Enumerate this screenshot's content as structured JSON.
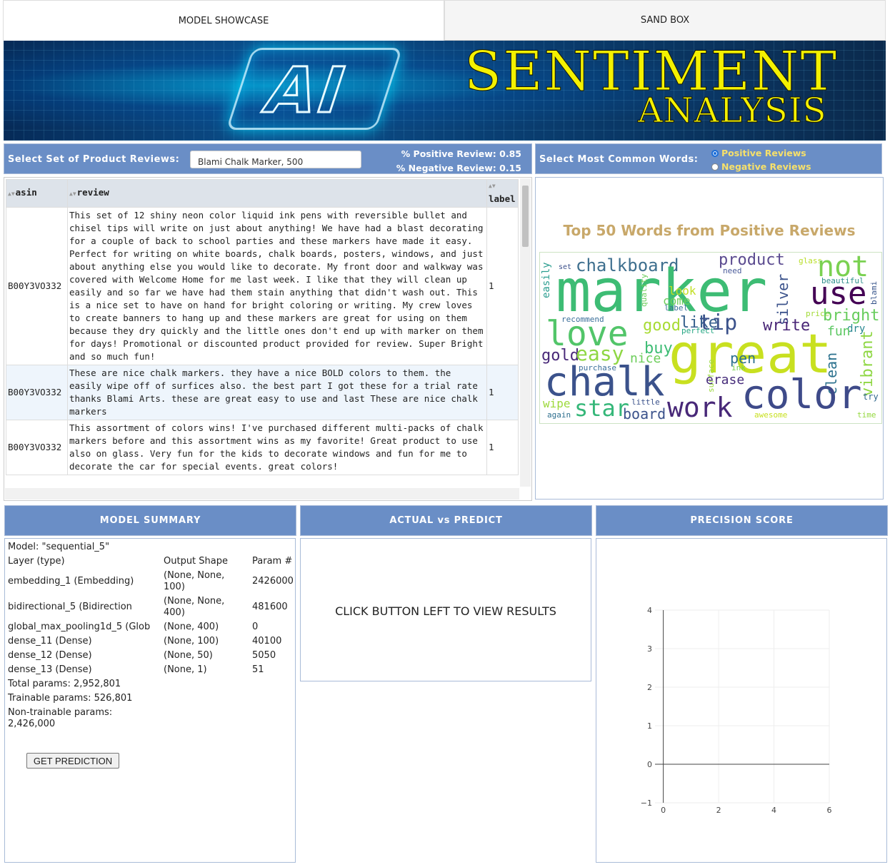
{
  "tabs": [
    {
      "label": "MODEL SHOWCASE"
    },
    {
      "label": "SAND BOX"
    }
  ],
  "banner": {
    "ai": "AI",
    "title": "SENTIMENT",
    "subtitle": "ANALYSIS"
  },
  "reviews_select": {
    "label": "Select Set of Product Reviews:",
    "value": "Blami Chalk Marker, 500",
    "positive": "% Positive Review: 0.85",
    "negative": "% Negative Review: 0.15"
  },
  "words_select": {
    "label": "Select Most Common Words:",
    "options": [
      "Positive Reviews",
      "Negative Reviews"
    ],
    "selected": "Positive Reviews"
  },
  "table": {
    "columns": [
      "asin",
      "review",
      "label"
    ],
    "rows": [
      {
        "asin": "B00Y3VO332",
        "review": "This set of 12 shiny neon color liquid ink pens with reversible bullet and chisel tips will write on just about anything! We have had a blast decorating for a couple of back to school parties and these markers have made it easy. Perfect for writing on white boards, chalk boards, posters, windows, and just about anything else you would like to decorate. My front door and walkway was covered with Welcome Home for me last week. I like that they will clean up easily and so far we have had them stain anything that didn't wash out. This is a nice set to have on hand for bright coloring or writing. My crew loves to create banners to hang up and these markers are great for using on them because they dry quickly and the little ones don't end up with marker on them for days! Promotional or discounted product provided for review. Super Bright and so much fun!",
        "label": "1"
      },
      {
        "asin": "B00Y3VO332",
        "review": "These are nice chalk markers. they have a nice BOLD colors to them. the easily wipe off of surfices also. the best part I got these for a trial rate thanks Blami Arts. these are great easy to use and last These are nice chalk markers",
        "label": "1"
      },
      {
        "asin": "B00Y3VO332",
        "review": "This assortment of colors wins! I've purchased different multi-packs of chalk markers before and this assortment wins as my favorite! Great product to use also on glass. Very fun for the kids to decorate windows and fun for me to decorate the car for special events. great colors!",
        "label": "1"
      }
    ]
  },
  "wordcloud": {
    "title": "Top 50 Words from Positive Reviews",
    "words": [
      {
        "text": "set",
        "color": "#3b4f8a"
      },
      {
        "text": "chalkboard",
        "color": "#3e6f8e"
      },
      {
        "text": "product",
        "color": "#5a4a8f"
      },
      {
        "text": "glass",
        "color": "#b8de29"
      },
      {
        "text": "not",
        "color": "#7ad151"
      },
      {
        "text": "need",
        "color": "#4a5b9a"
      },
      {
        "text": "marker",
        "color": "#3dbc74"
      },
      {
        "text": "use",
        "color": "#440154"
      },
      {
        "text": "beautiful",
        "color": "#2e8f8b"
      },
      {
        "text": "easily",
        "color": "#2a9d8f"
      },
      {
        "text": "quality",
        "color": "#6ccd5a"
      },
      {
        "text": "look",
        "color": "#c2df23"
      },
      {
        "text": "come",
        "color": "#6ccd5a"
      },
      {
        "text": "label",
        "color": "#3b6f9a"
      },
      {
        "text": "silver",
        "color": "#3b528b"
      },
      {
        "text": "blami",
        "color": "#39568c"
      },
      {
        "text": "price",
        "color": "#a2da37"
      },
      {
        "text": "recommend",
        "color": "#3b6f9a"
      },
      {
        "text": "bright",
        "color": "#67cc5c"
      },
      {
        "text": "love",
        "color": "#52c569"
      },
      {
        "text": "good",
        "color": "#a8db34"
      },
      {
        "text": "like",
        "color": "#355f8d"
      },
      {
        "text": "tip",
        "color": "#3b528b"
      },
      {
        "text": "perfect",
        "color": "#26a784"
      },
      {
        "text": "write",
        "color": "#482576"
      },
      {
        "text": "dry",
        "color": "#25858e"
      },
      {
        "text": "fun",
        "color": "#5dc863"
      },
      {
        "text": "vibrant",
        "color": "#8fd744"
      },
      {
        "text": "great",
        "color": "#c8e020"
      },
      {
        "text": "buy",
        "color": "#3dbc74"
      },
      {
        "text": "gold",
        "color": "#482878"
      },
      {
        "text": "easy",
        "color": "#8fd744"
      },
      {
        "text": "nice",
        "color": "#6ccd5a"
      },
      {
        "text": "pen",
        "color": "#2d708e"
      },
      {
        "text": "surface",
        "color": "#9bd93c"
      },
      {
        "text": "purchase",
        "color": "#3b6f9a"
      },
      {
        "text": "ink",
        "color": "#7ad151"
      },
      {
        "text": "clean",
        "color": "#2c728e"
      },
      {
        "text": "chalk",
        "color": "#3b528b"
      },
      {
        "text": "erase",
        "color": "#472d7b"
      },
      {
        "text": "color",
        "color": "#3e4a89"
      },
      {
        "text": "wipe",
        "color": "#9dd93b"
      },
      {
        "text": "star",
        "color": "#35b779"
      },
      {
        "text": "little",
        "color": "#3b528b"
      },
      {
        "text": "work",
        "color": "#482878"
      },
      {
        "text": "try",
        "color": "#31688e"
      },
      {
        "text": "board",
        "color": "#3b528b"
      },
      {
        "text": "again",
        "color": "#2e6f8e"
      },
      {
        "text": "awesome",
        "color": "#c8e020"
      },
      {
        "text": "time",
        "color": "#95d840"
      }
    ]
  },
  "model_summary": {
    "header": "MODEL SUMMARY",
    "model": "Model: \"sequential_5\"",
    "col_layer": "Layer (type)",
    "col_shape": "Output Shape",
    "col_param": "Param #",
    "layers": [
      {
        "name": "embedding_1 (Embedding)",
        "shape": "(None, None, 100)",
        "params": "2426000"
      },
      {
        "name": "bidirectional_5 (Bidirection",
        "shape": "(None, None, 400)",
        "params": "481600"
      },
      {
        "name": "global_max_pooling1d_5 (Glob",
        "shape": "(None, 400)",
        "params": "0"
      },
      {
        "name": "dense_11 (Dense)",
        "shape": "(None, 100)",
        "params": "40100"
      },
      {
        "name": "dense_12 (Dense)",
        "shape": "(None, 50)",
        "params": "5050"
      },
      {
        "name": "dense_13 (Dense)",
        "shape": "(None, 1)",
        "params": "51"
      }
    ],
    "total": "Total params: 2,952,801",
    "trainable": "Trainable params: 526,801",
    "nontrainable": "Non-trainable params: 2,426,000",
    "button": "GET PREDICTION"
  },
  "actual_vs_predict": {
    "header": "ACTUAL vs PREDICT",
    "message": "CLICK BUTTON LEFT TO VIEW RESULTS"
  },
  "precision": {
    "header": "PRECISION SCORE"
  },
  "chart_data": {
    "type": "line",
    "title": "",
    "xlabel": "",
    "ylabel": "",
    "series": [],
    "xlim": [
      -0.3,
      6
    ],
    "ylim": [
      -1,
      4
    ],
    "xticks": [
      0,
      2,
      4,
      6
    ],
    "yticks": [
      -1,
      0,
      1,
      2,
      3,
      4
    ],
    "grid": true
  }
}
